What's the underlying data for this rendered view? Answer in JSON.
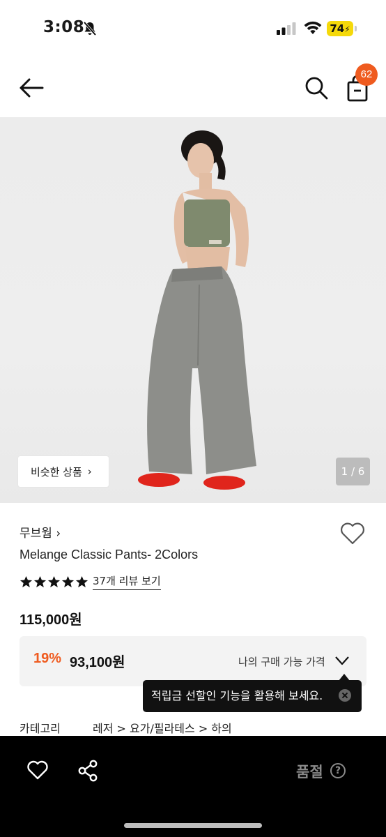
{
  "status_bar": {
    "time": "3:08",
    "battery": "74"
  },
  "nav": {
    "cart_count": "62"
  },
  "gallery": {
    "similar_label": "비슷한 상품",
    "counter": "1 / 6"
  },
  "product": {
    "brand": "무브웜",
    "name": "Melange Classic Pants- 2Colors",
    "rating_stars": 5,
    "review_label": "37개 리뷰 보기",
    "original_price": "115,000원",
    "discount": "19%",
    "sale_price": "93,100원",
    "my_price_label": "나의 구매 가능 가격",
    "tooltip": "적립금 선할인 기능을 활용해 보세요.",
    "category_label": "카테고리",
    "category_path": "레저 > 요가/필라테스 > 하의"
  },
  "bottom_bar": {
    "status": "품절",
    "help": "?"
  },
  "colors": {
    "accent": "#ef5b1f",
    "bottom_bar": "#000000"
  }
}
